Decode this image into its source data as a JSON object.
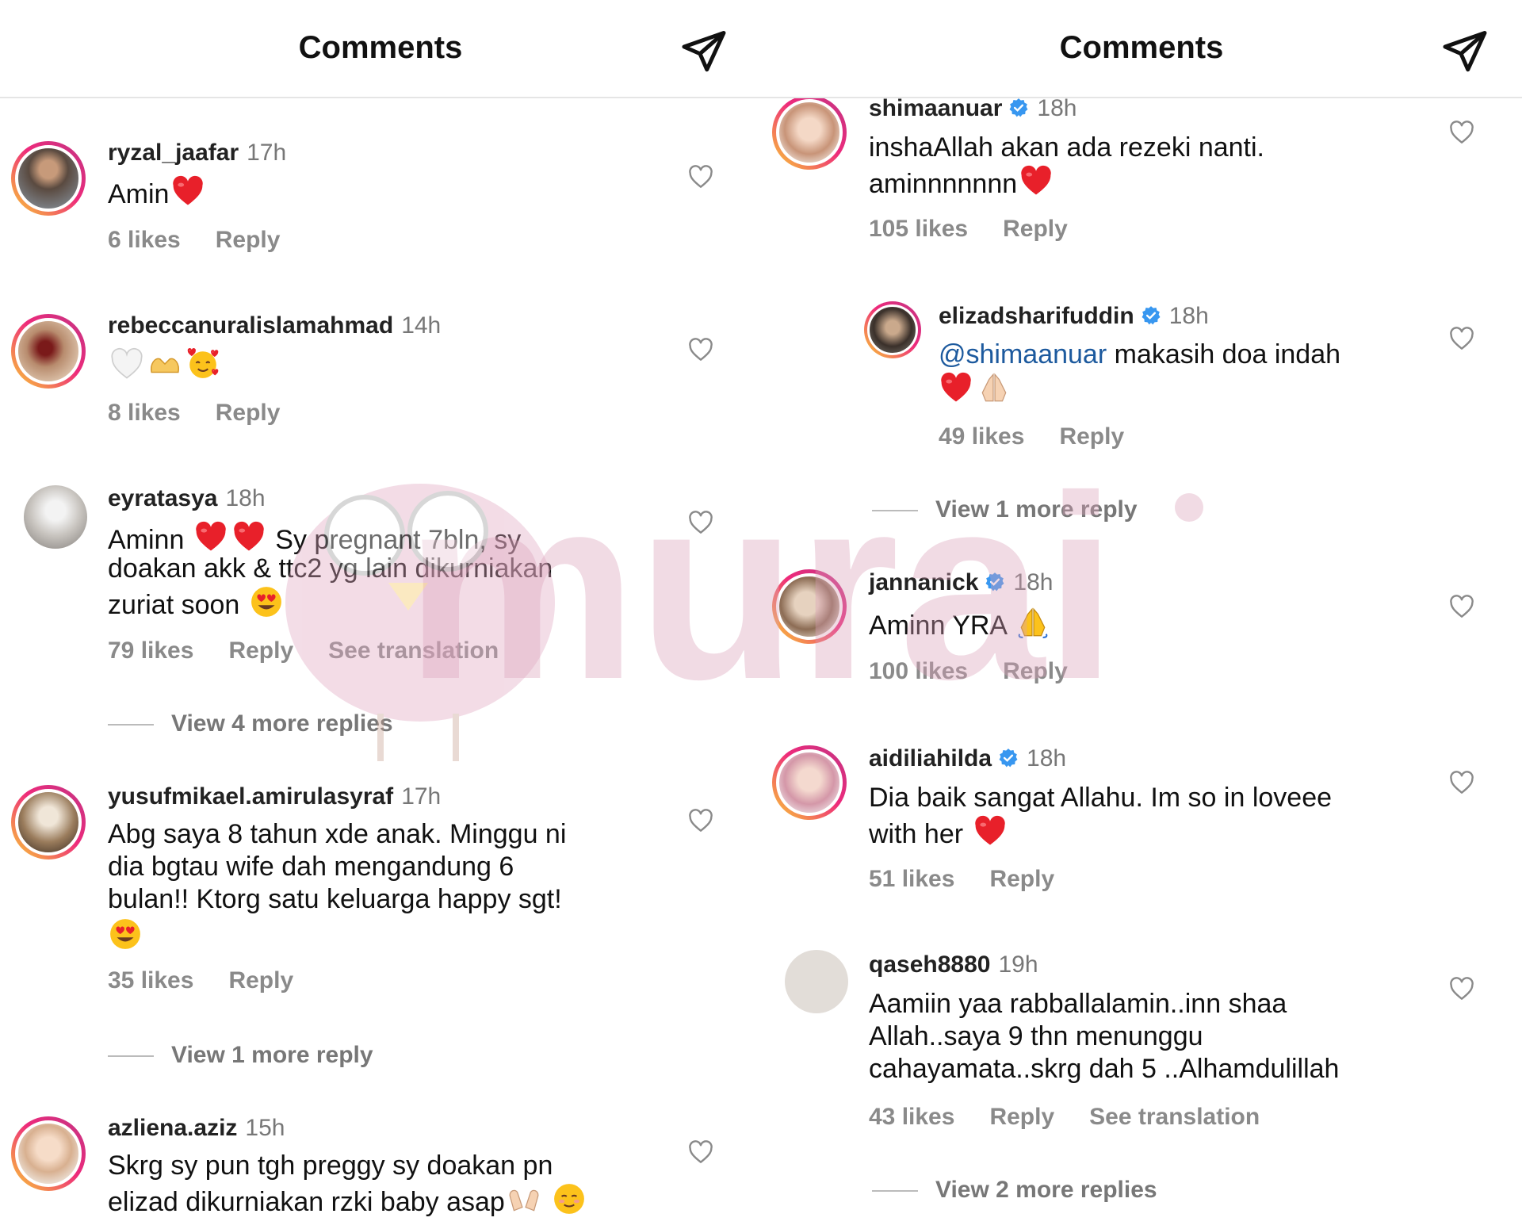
{
  "left": {
    "header": {
      "title": "Comments",
      "send_icon": "paper-plane-icon"
    },
    "comments": [
      {
        "username": "ryzal_jaafar",
        "time": "17h",
        "text": "Amin",
        "likes": "6 likes",
        "reply": "Reply"
      },
      {
        "username": "rebeccanuralislamahmad",
        "time": "14h",
        "text": "",
        "likes": "8 likes",
        "reply": "Reply"
      },
      {
        "username": "eyratasya",
        "time": "18h",
        "line1": "Aminn",
        "line1b": "Sy pregnant 7bln, sy",
        "line2": "doakan akk & ttc2 yg lain dikurniakan",
        "line3": "zuriat soon",
        "likes": "79 likes",
        "reply": "Reply",
        "translate": "See translation",
        "view_more": "View 4 more replies"
      },
      {
        "username": "yusufmikael.amirulasyraf",
        "time": "17h",
        "line1": "Abg saya 8 tahun xde anak. Minggu ni",
        "line2": "dia bgtau wife dah mengandung 6",
        "line3": "bulan!! Ktorg satu keluarga happy sgt!",
        "likes": "35 likes",
        "reply": "Reply",
        "view_more": "View 1 more reply"
      },
      {
        "username": "azliena.aziz",
        "time": "15h",
        "line1": "Skrg sy pun tgh preggy sy doakan pn",
        "line2": "elizad dikurniakan rzki baby asap"
      }
    ]
  },
  "right": {
    "header": {
      "title": "Comments",
      "send_icon": "paper-plane-icon"
    },
    "comments": [
      {
        "username": "shimaanuar",
        "time": "18h",
        "line1": "inshaAllah akan ada rezeki nanti.",
        "line2": "aminnnnnnn",
        "likes": "105 likes",
        "reply": "Reply"
      },
      {
        "username": "elizadsharifuddin",
        "time": "18h",
        "mention": "@shimaanuar",
        "line1": " makasih doa indah",
        "likes": "49 likes",
        "reply": "Reply",
        "view_more": "View 1 more reply"
      },
      {
        "username": "jannanick",
        "time": "18h",
        "line1": "Aminn YRA",
        "likes": "100 likes",
        "reply": "Reply"
      },
      {
        "username": "aidiliahilda",
        "time": "18h",
        "line1": "Dia baik sangat Allahu. Im so in loveee",
        "line2": "with her",
        "likes": "51 likes",
        "reply": "Reply"
      },
      {
        "username": "qaseh8880",
        "time": "19h",
        "line1": "Aamiin yaa rabballalamin..inn shaa",
        "line2": "Allah..saya 9 thn menunggu",
        "line3": "cahayamata..skrg dah 5 ..Alhamdulillah",
        "likes": "43 likes",
        "reply": "Reply",
        "translate": "See translation",
        "view_more": "View 2 more replies"
      }
    ]
  },
  "watermark": {
    "text": "murai"
  },
  "colors": {
    "heart": "#e8202a",
    "ring_start": "#f9ce34",
    "ring_end": "#c13584",
    "verified": "#3897f0",
    "mention": "#1d5a9e"
  }
}
